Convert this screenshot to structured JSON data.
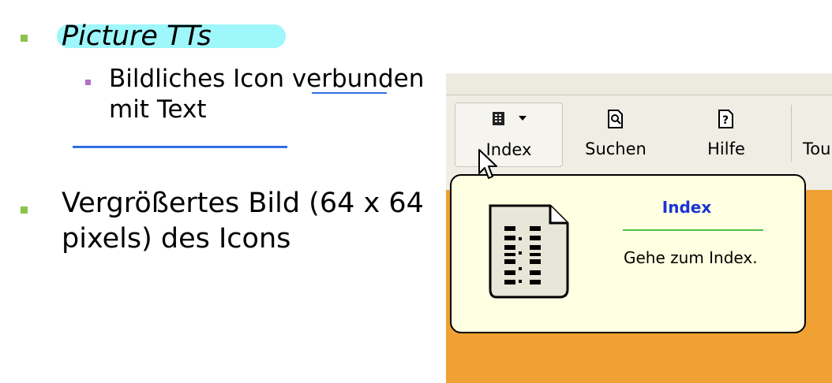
{
  "slide": {
    "bullet1": "Picture TTs",
    "sub1_line1": "Bildliches Icon verbunden",
    "sub1_line2": "mit Text",
    "bullet2_line1": "Vergrößertes Bild (64 x 64",
    "bullet2_line2": "pixels) des Icons"
  },
  "toolbar": {
    "index_label": "Index",
    "search_label": "Suchen",
    "help_label": "Hilfe",
    "tour_label": "Tou"
  },
  "tooltip": {
    "title": "Index",
    "description": "Gehe zum Index."
  },
  "colors": {
    "bullet_main": "#8bc34a",
    "bullet_sub": "#b070c8",
    "highlight": "#9ef7fb",
    "accent_line": "#2f6fe6",
    "tooltip_title": "#1a33d6",
    "tooltip_bg": "#ffffe1",
    "background_orange": "#efa133"
  }
}
